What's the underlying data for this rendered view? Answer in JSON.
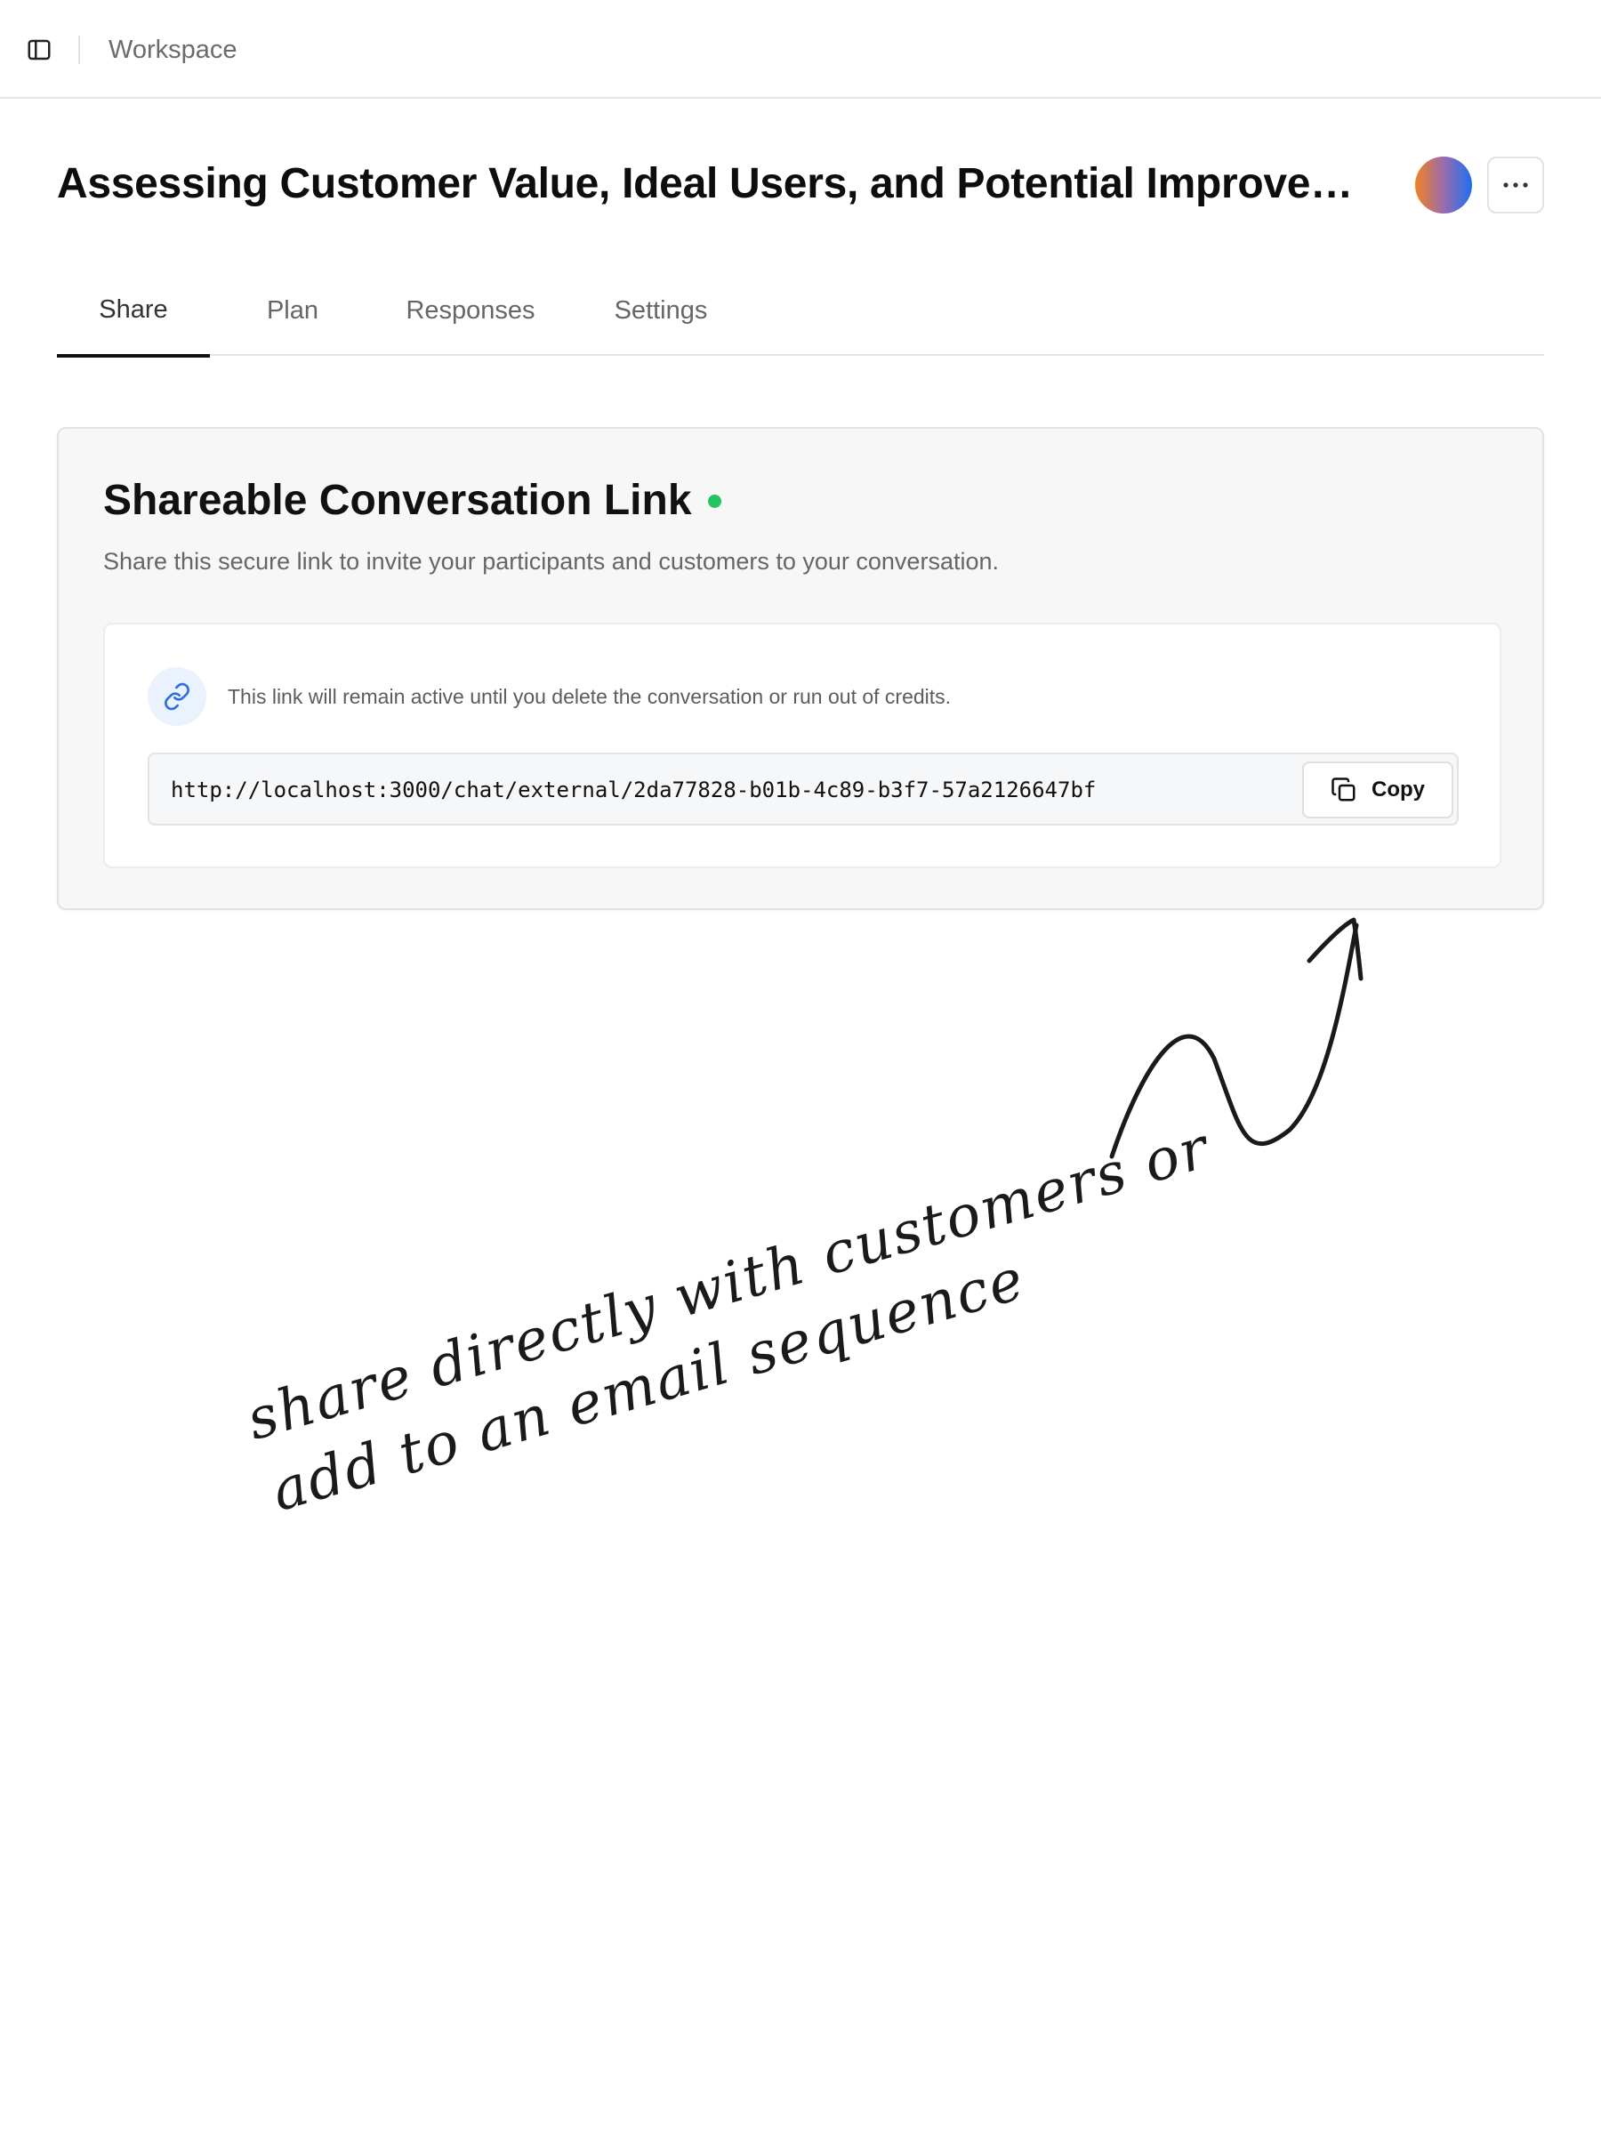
{
  "topbar": {
    "breadcrumb": "Workspace",
    "sidebar_icon": "sidebar-toggle-icon"
  },
  "header": {
    "title": "Assessing Customer Value, Ideal Users, and Potential Improvements",
    "avatar_colors": [
      "#f28322",
      "#1f6ff0"
    ],
    "more_icon": "ellipsis-icon"
  },
  "tabs": [
    {
      "label": "Share",
      "active": true
    },
    {
      "label": "Plan",
      "active": false
    },
    {
      "label": "Responses",
      "active": false
    },
    {
      "label": "Settings",
      "active": false
    }
  ],
  "share_card": {
    "title": "Shareable Conversation Link",
    "status_color": "#22c55e",
    "description": "Share this secure link to invite your participants and customers to your conversation.",
    "notice": "This link will remain active until you delete the conversation or run out of credits.",
    "notice_icon": "link-icon",
    "url": "http://localhost:3000/chat/external/2da77828-b01b-4c89-b3f7-57a2126647bf",
    "copy_label": "Copy",
    "copy_icon": "copy-icon"
  },
  "annotation": {
    "line1": "share directly with customers or",
    "line2": "add to an email sequence"
  },
  "colors": {
    "accent_blue": "#1f6ff0",
    "text_primary": "#111111",
    "text_muted": "#666666",
    "border": "#e3e3e3"
  }
}
